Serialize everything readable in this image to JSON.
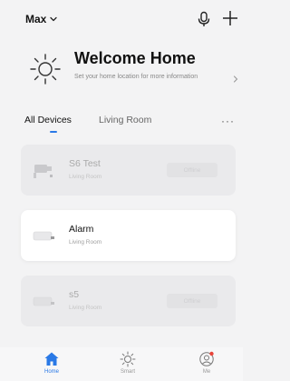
{
  "header": {
    "home_name": "Max",
    "icons": [
      "chevron-down-icon",
      "microphone-icon",
      "plus-icon"
    ]
  },
  "welcome": {
    "title": "Welcome Home",
    "subtitle": "Set your home location for more information",
    "icon": "sun-icon"
  },
  "tabs": [
    {
      "label": "All Devices",
      "active": true
    },
    {
      "label": "Living Room",
      "active": false
    }
  ],
  "more_label": "···",
  "devices": [
    {
      "name": "S6 Test",
      "room": "Living Room",
      "online": false,
      "status": "Offline",
      "icon": "camera-icon"
    },
    {
      "name": "Alarm",
      "room": "Living Room",
      "online": true,
      "status": "",
      "icon": "alarm-device-icon"
    },
    {
      "name": "s5",
      "room": "Living Room",
      "online": false,
      "status": "Offline",
      "icon": "alarm-device-icon"
    }
  ],
  "nav": [
    {
      "label": "Home",
      "icon": "home-icon",
      "active": true
    },
    {
      "label": "Smart",
      "icon": "sun-icon",
      "active": false
    },
    {
      "label": "Me",
      "icon": "user-icon",
      "active": false
    }
  ],
  "colors": {
    "accent": "#2a79e6",
    "background": "#f3f3f4",
    "notification": "#e8443a"
  }
}
